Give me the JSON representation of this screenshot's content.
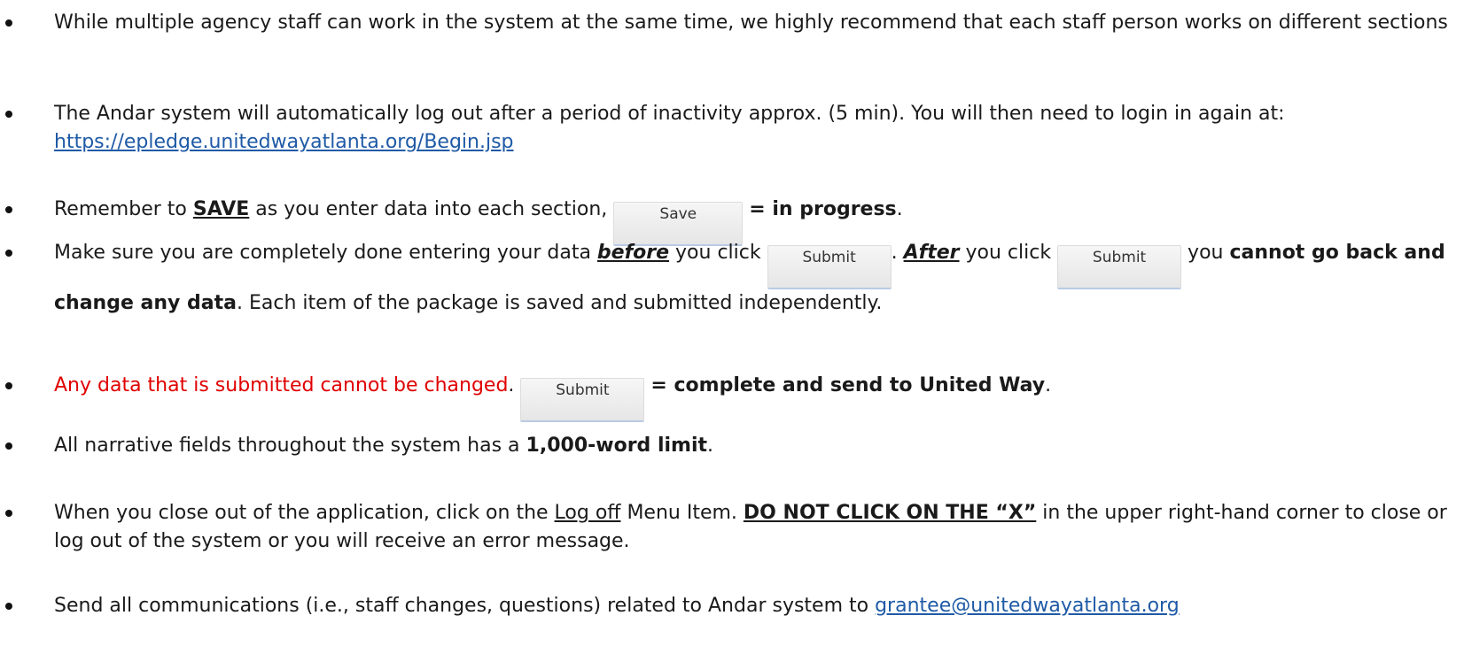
{
  "bullets": {
    "b1": "While multiple agency staff can work in the system at the same time, we highly recommend that each staff person works on different sections",
    "b2_text": "The Andar system will automatically log out after a period of inactivity approx. (5 min). You will then need to login in again at: ",
    "b2_link": "https://epledge.unitedwayatlanta.org/Begin.jsp",
    "b3_pre": "Remember to ",
    "b3_save": "SAVE",
    "b3_mid": " as you enter data into each section, ",
    "b3_bold": "= in progress",
    "b3_end": ".",
    "b4_pre": "Make sure you are completely done entering your data ",
    "b4_before": "before",
    "b4_click": " you click ",
    "b4_dot": ". ",
    "b4_after": "After",
    "b4_click2": " you click ",
    "b4_you": " you ",
    "b4_bold": "cannot go back and change any data",
    "b4_end": ". Each item of the package is saved and submitted independently.",
    "b5_red": "Any data that is submitted cannot be changed",
    "b5_dot": ". ",
    "b5_bold": "= complete and send to United Way",
    "b5_end": ".",
    "b6_pre": "All narrative fields throughout the system has a ",
    "b6_bold": "1,000-word limit",
    "b6_end": ".",
    "b7_pre": "When you close out of the application, click on the ",
    "b7_logoff": "Log off",
    "b7_mid": " Menu Item. ",
    "b7_bold": "DO NOT CLICK ON THE “X”",
    "b7_end": " in the upper right-hand corner to close or log out of the system or you will receive an error message.",
    "b8_pre": "Send all communications (i.e., staff changes, questions) related to Andar system to ",
    "b8_link": "grantee@unitedwayatlanta.org"
  },
  "buttons": {
    "save_label": "Save",
    "submit_label": "Submit"
  },
  "colors": {
    "link": "#1f5aa6",
    "warning": "#e00000"
  }
}
